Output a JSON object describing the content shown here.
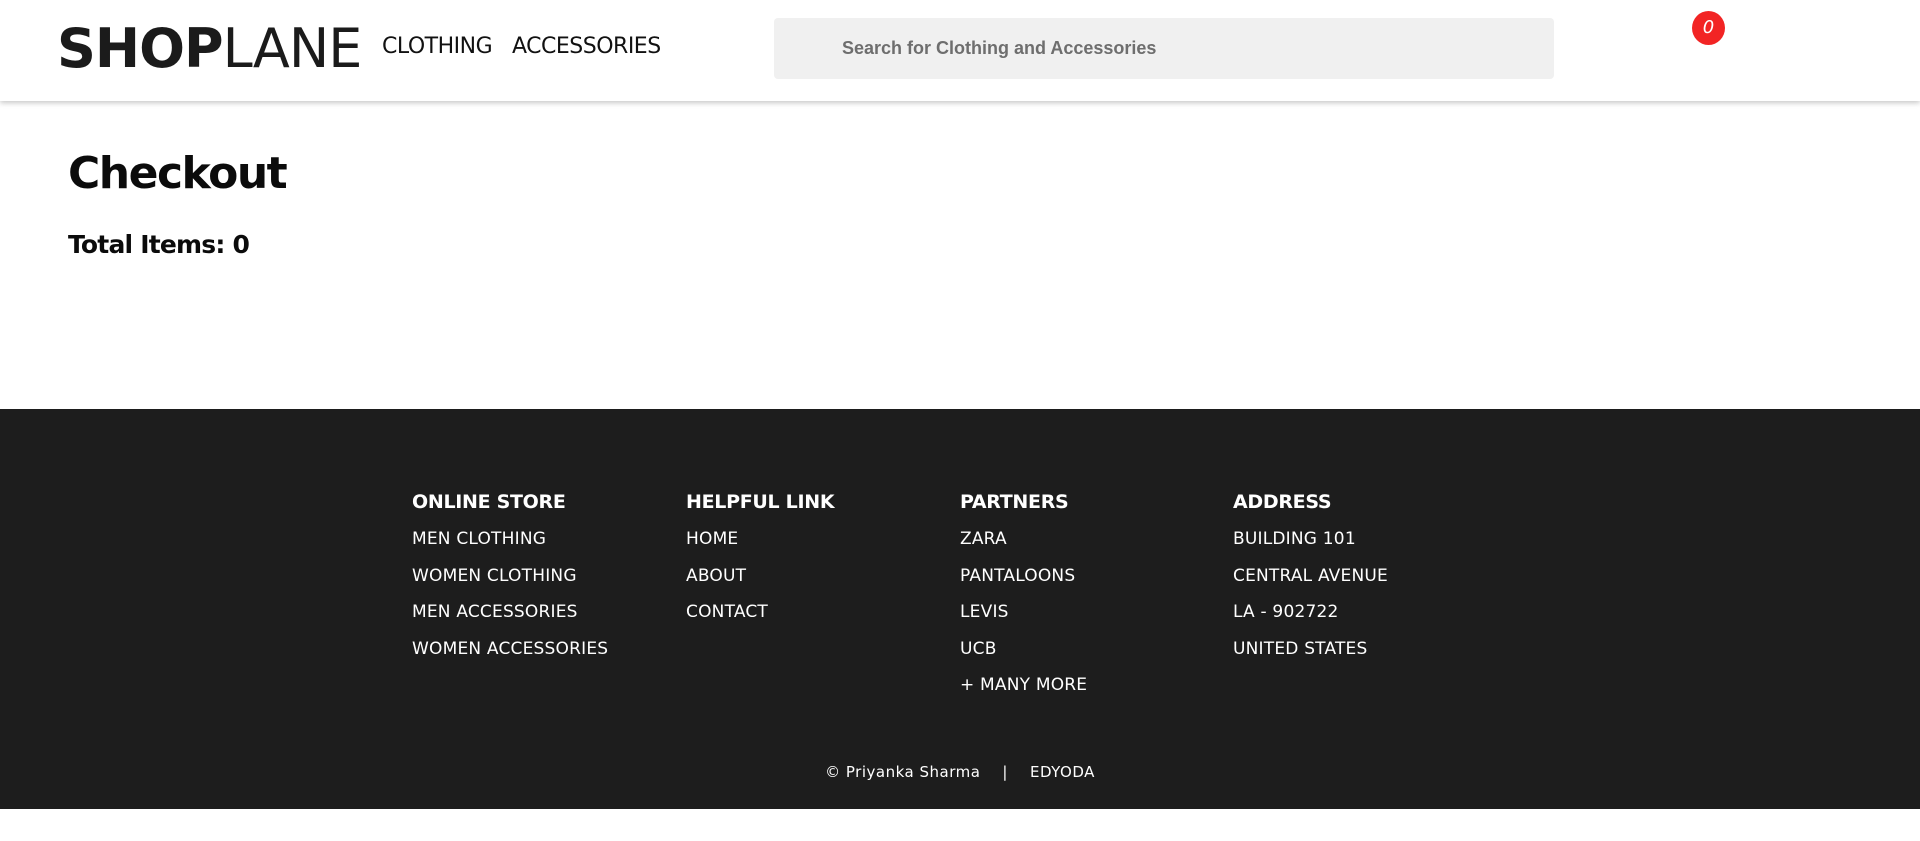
{
  "header": {
    "logo_bold": "SHOP",
    "logo_light": "LANE",
    "nav": [
      "CLOTHING",
      "ACCESSORIES"
    ],
    "search_placeholder": "Search for Clothing and Accessories",
    "cart_count": "0",
    "cart_badge_color": "#f22424"
  },
  "main": {
    "title": "Checkout",
    "total_items_label": "Total Items:",
    "total_items_value": "0"
  },
  "footer": {
    "background": "#1d1d1d",
    "columns": [
      {
        "title": "ONLINE STORE",
        "items": [
          "MEN CLOTHING",
          "WOMEN CLOTHING",
          "MEN ACCESSORIES",
          "WOMEN ACCESSORIES"
        ]
      },
      {
        "title": "HELPFUL LINK",
        "items": [
          "HOME",
          "ABOUT",
          "CONTACT"
        ]
      },
      {
        "title": "PARTNERS",
        "items": [
          "ZARA",
          "PANTALOONS",
          "LEVIS",
          "UCB",
          "+ MANY MORE"
        ]
      },
      {
        "title": "ADDRESS",
        "items": [
          "BUILDING 101",
          "CENTRAL AVENUE",
          "LA - 902722",
          "UNITED STATES"
        ]
      }
    ],
    "copyright": "© Priyanka Sharma",
    "separator": "|",
    "brand": "EDYODA"
  }
}
